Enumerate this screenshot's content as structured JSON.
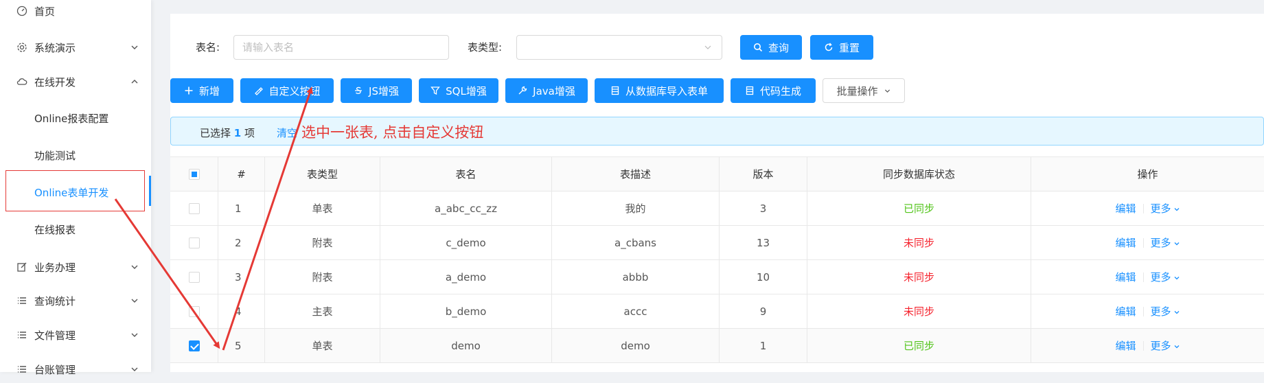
{
  "sidebar": {
    "items": [
      {
        "label": "首页",
        "icon": "dashboard-icon"
      },
      {
        "label": "系统演示",
        "icon": "gear-icon"
      },
      {
        "label": "在线开发",
        "icon": "cloud-icon"
      },
      {
        "label": "Online报表配置"
      },
      {
        "label": "功能测试"
      },
      {
        "label": "Online表单开发"
      },
      {
        "label": "在线报表"
      },
      {
        "label": "业务办理",
        "icon": "edit-icon"
      },
      {
        "label": "查询统计",
        "icon": "list-icon"
      },
      {
        "label": "文件管理",
        "icon": "list-icon"
      },
      {
        "label": "台账管理",
        "icon": "list-icon"
      }
    ]
  },
  "search": {
    "table_name_label": "表名:",
    "table_name_placeholder": "请输入表名",
    "table_type_label": "表类型:",
    "table_type_value": "",
    "query_label": "查询",
    "reset_label": "重置"
  },
  "toolbar": {
    "add": "新增",
    "custom_button": "自定义按钮",
    "js_enhance": "JS增强",
    "sql_enhance": "SQL增强",
    "java_enhance": "Java增强",
    "import_db": "从数据库导入表单",
    "code_gen": "代码生成",
    "batch": "批量操作"
  },
  "alert": {
    "prefix": "已选择 ",
    "count": "1",
    "suffix": " 项",
    "clear": "清空",
    "annotation": "选中一张表, 点击自定义按钮"
  },
  "table": {
    "headers": [
      "#",
      "表类型",
      "表名",
      "表描述",
      "版本",
      "同步数据库状态",
      "操作"
    ],
    "rows": [
      {
        "no": "1",
        "type": "单表",
        "name": "a_abc_cc_zz",
        "desc": "我的",
        "version": "3",
        "status": "已同步",
        "synced": true,
        "selected": false
      },
      {
        "no": "2",
        "type": "附表",
        "name": "c_demo",
        "desc": "a_cbans",
        "version": "13",
        "status": "未同步",
        "synced": false,
        "selected": false
      },
      {
        "no": "3",
        "type": "附表",
        "name": "a_demo",
        "desc": "abbb",
        "version": "10",
        "status": "未同步",
        "synced": false,
        "selected": false
      },
      {
        "no": "4",
        "type": "主表",
        "name": "b_demo",
        "desc": "accc",
        "version": "9",
        "status": "未同步",
        "synced": false,
        "selected": false
      },
      {
        "no": "5",
        "type": "单表",
        "name": "demo",
        "desc": "demo",
        "version": "1",
        "status": "已同步",
        "synced": true,
        "selected": true
      }
    ],
    "edit_label": "编辑",
    "more_label": "更多"
  },
  "colors": {
    "primary": "#1890ff",
    "synced": "#52c41a",
    "unsynced": "#f5222d",
    "annotation": "#e53935"
  }
}
